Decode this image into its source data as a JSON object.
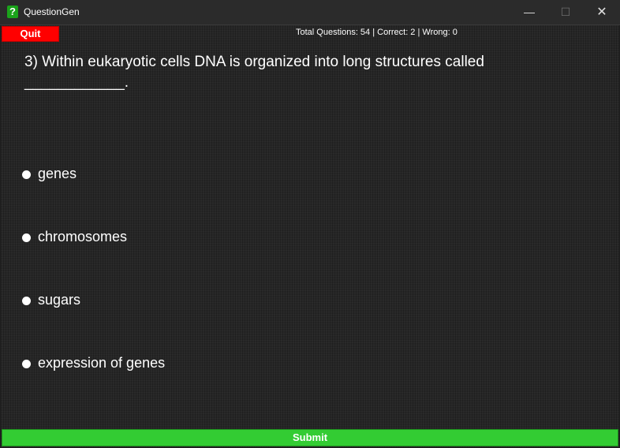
{
  "window": {
    "title": "QuestionGen",
    "app_icon": "question-mark-icon",
    "minimize_glyph": "—",
    "maximize_glyph": "☐",
    "close_glyph": "✕"
  },
  "toolbar": {
    "quit_label": "Quit",
    "stats": "Total Questions: 54 | Correct: 2 | Wrong: 0"
  },
  "question": {
    "text": "3) Within eukaryotic cells DNA is organized into long structures called ____________."
  },
  "options": [
    {
      "label": "genes"
    },
    {
      "label": "chromosomes"
    },
    {
      "label": "sugars"
    },
    {
      "label": "expression of genes"
    }
  ],
  "footer": {
    "submit_label": "Submit"
  },
  "colors": {
    "quit": "#ff0000",
    "submit": "#33cc33",
    "background": "#262626"
  }
}
